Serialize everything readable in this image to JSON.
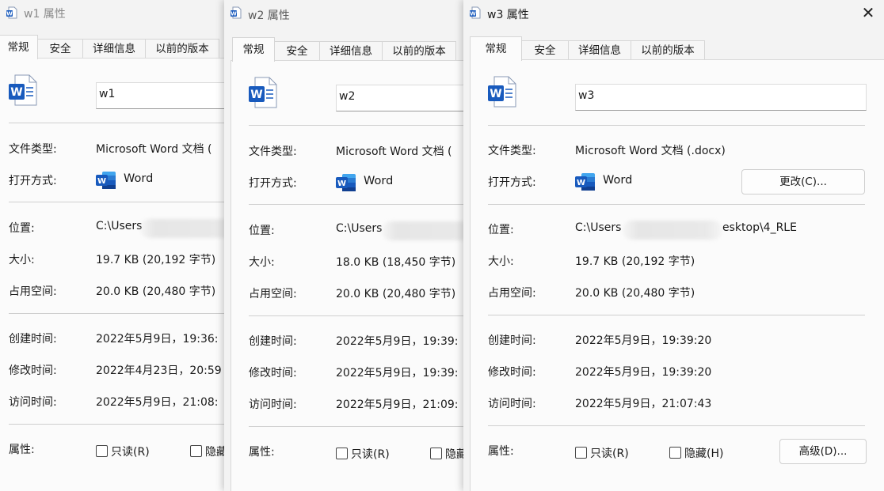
{
  "tabs": [
    "常规",
    "安全",
    "详细信息",
    "以前的版本"
  ],
  "labels": {
    "file_type": "文件类型:",
    "open_with": "打开方式:",
    "location": "位置:",
    "size": "大小:",
    "size_on_disk": "占用空间:",
    "created": "创建时间:",
    "modified": "修改时间:",
    "accessed": "访问时间:",
    "attributes": "属性:"
  },
  "attrs": {
    "readonly": "只读(R)",
    "hidden": "隐藏(H)",
    "hidden_clipped": "隐藏",
    "advanced_button": "高级(D)..."
  },
  "app": {
    "name": "Word",
    "change_button": "更改(C)..."
  },
  "windows": [
    {
      "title": "w1 属性",
      "name": "w1",
      "file_type": "Microsoft Word 文档 (",
      "location": "C:\\Users",
      "size": "19.7 KB (20,192 字节)",
      "size_on_disk": "20.0 KB (20,480 字节)",
      "created": "2022年5月9日，19:36:",
      "modified": "2022年4月23日，20:59",
      "accessed": "2022年5月9日，21:08:"
    },
    {
      "title": "w2 属性",
      "name": "w2",
      "file_type": "Microsoft Word 文档 (",
      "location": "C:\\Users",
      "size": "18.0 KB (18,450 字节)",
      "size_on_disk": "20.0 KB (20,480 字节)",
      "created": "2022年5月9日，19:39:",
      "modified": "2022年5月9日，19:39:",
      "accessed": "2022年5月9日，21:09:"
    },
    {
      "title": "w3 属性",
      "name": "w3",
      "file_type": "Microsoft Word 文档 (.docx)",
      "location": "C:\\Users",
      "location_tail": "esktop\\4_RLE",
      "size": "19.7 KB (20,192 字节)",
      "size_on_disk": "20.0 KB (20,480 字节)",
      "created": "2022年5月9日，19:39:20",
      "modified": "2022年5月9日，19:39:20",
      "accessed": "2022年5月9日，21:07:43"
    }
  ],
  "icons": [
    "word-file-icon",
    "word-app-icon",
    "close-icon",
    "checkbox-icon"
  ],
  "colors": {
    "word_blue": "#185abd",
    "word_dark": "#103f91"
  }
}
